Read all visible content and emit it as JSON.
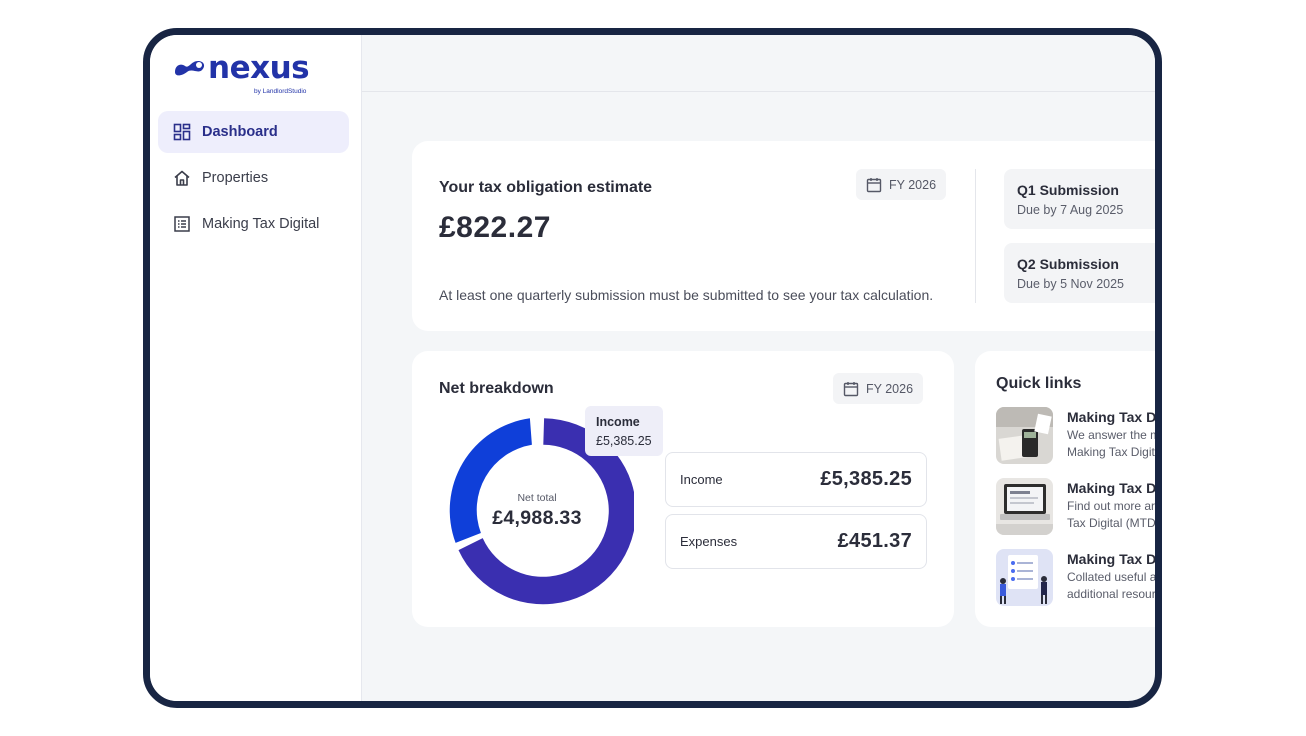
{
  "brand": {
    "name": "nexus",
    "sub": "by LandlordStudio",
    "color": "#2233a8"
  },
  "sidebar": {
    "items": [
      {
        "label": "Dashboard",
        "icon": "dashboard-icon",
        "active": true
      },
      {
        "label": "Properties",
        "icon": "home-icon",
        "active": false
      },
      {
        "label": "Making Tax Digital",
        "icon": "list-icon",
        "active": false
      }
    ]
  },
  "tax": {
    "title": "Your tax obligation estimate",
    "amount": "£822.27",
    "fy": "FY 2026",
    "note": "At least one quarterly submission must be submitted to see your tax calculation.",
    "submissions": [
      {
        "title": "Q1 Submission",
        "due": "Due by 7 Aug 2025"
      },
      {
        "title": "Q2 Submission",
        "due": "Due by 5 Nov 2025"
      }
    ]
  },
  "net": {
    "title": "Net breakdown",
    "fy": "FY 2026",
    "tooltip": {
      "label": "Income",
      "value": "£5,385.25"
    },
    "center_label": "Net total",
    "center_value": "£4,988.33",
    "income_label": "Income",
    "income_value": "£5,385.25",
    "expenses_label": "Expenses",
    "expenses_value": "£451.37",
    "colors": {
      "income": "#3a2fb0",
      "expenses": "#0f3fd9"
    }
  },
  "quick_links": {
    "title": "Quick links",
    "items": [
      {
        "title": "Making Tax Di",
        "desc1": "We answer the m",
        "desc2": "Making Tax Digit"
      },
      {
        "title": "Making Tax Di",
        "desc1": "Find out more ar",
        "desc2": "Tax Digital (MTD"
      },
      {
        "title": "Making Tax Di",
        "desc1": "Collated useful a",
        "desc2": "additional resour"
      }
    ]
  }
}
